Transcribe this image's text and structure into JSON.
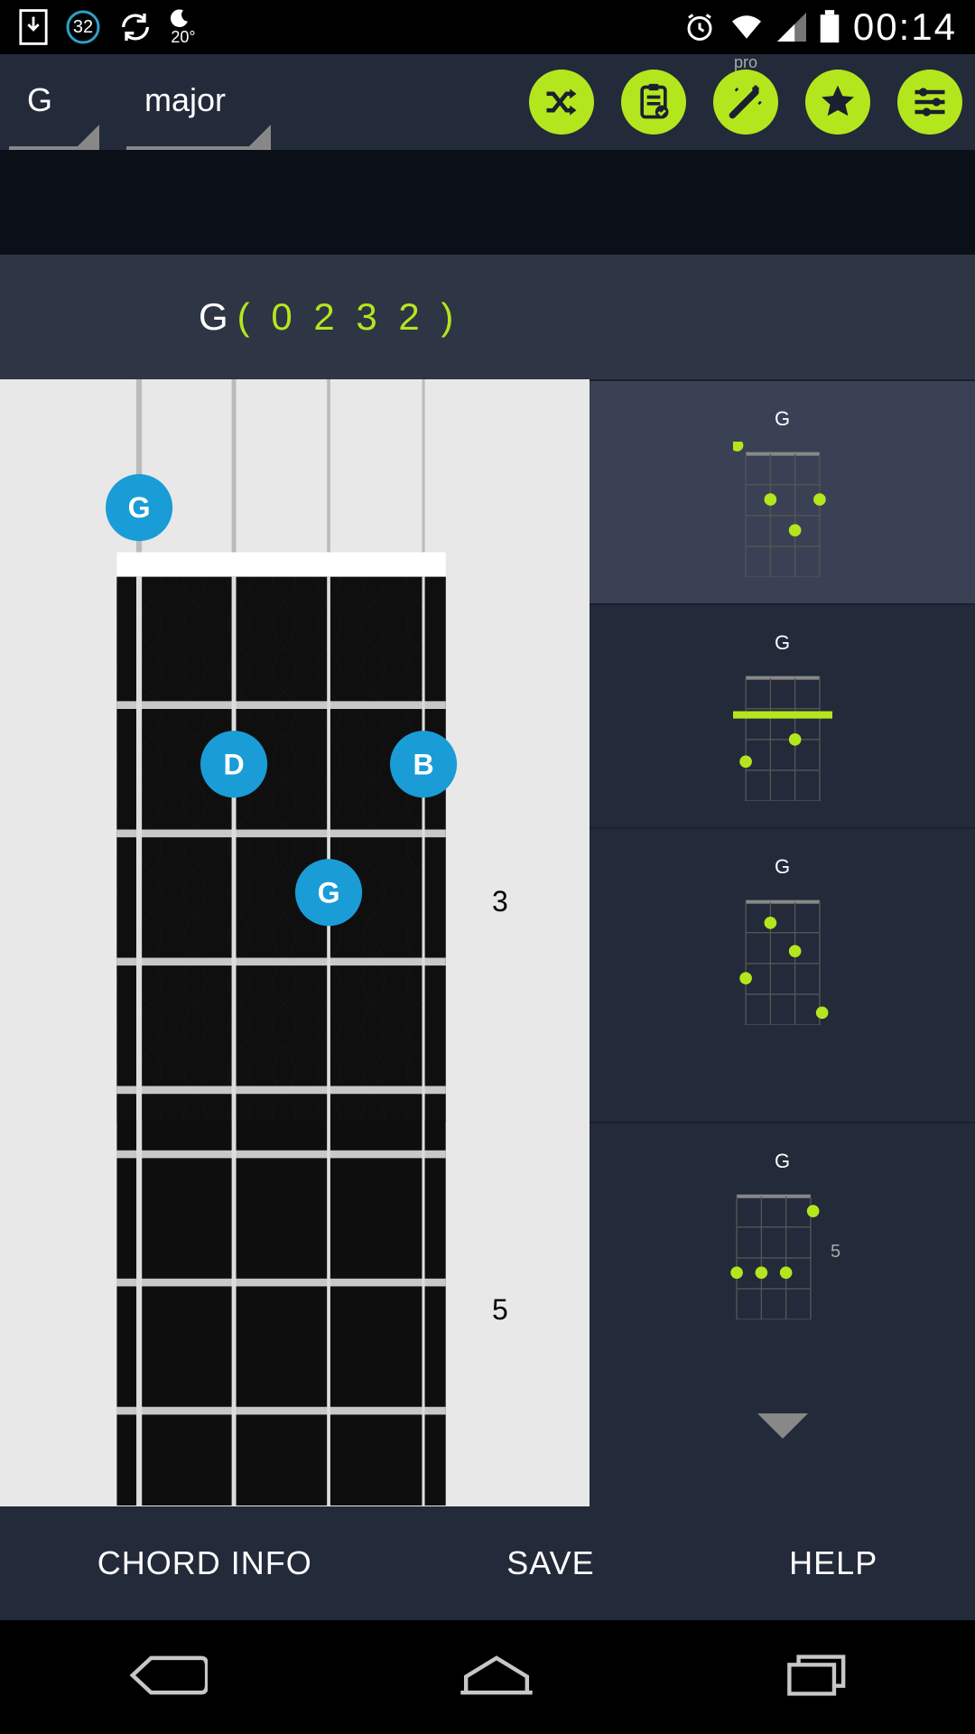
{
  "status": {
    "temp": "20°",
    "time": "00:14",
    "badge": "32"
  },
  "toolbar": {
    "root": "G",
    "quality": "major",
    "pro_label": "pro"
  },
  "chord": {
    "root_label": "G",
    "tab_label": "( 0 2 3 2 )",
    "fret_labels": {
      "three": "3",
      "five": "5"
    },
    "dots": [
      {
        "note": "G",
        "string": 0,
        "fret": 0
      },
      {
        "note": "D",
        "string": 1,
        "fret": 2
      },
      {
        "note": "G",
        "string": 2,
        "fret": 3
      },
      {
        "note": "B",
        "string": 3,
        "fret": 2
      }
    ]
  },
  "variations": [
    {
      "label": "G"
    },
    {
      "label": "G"
    },
    {
      "label": "G"
    },
    {
      "label": "G",
      "side_fret": "5"
    }
  ],
  "bottom": {
    "chord_info": "CHORD INFO",
    "save": "SAVE",
    "help": "HELP"
  }
}
